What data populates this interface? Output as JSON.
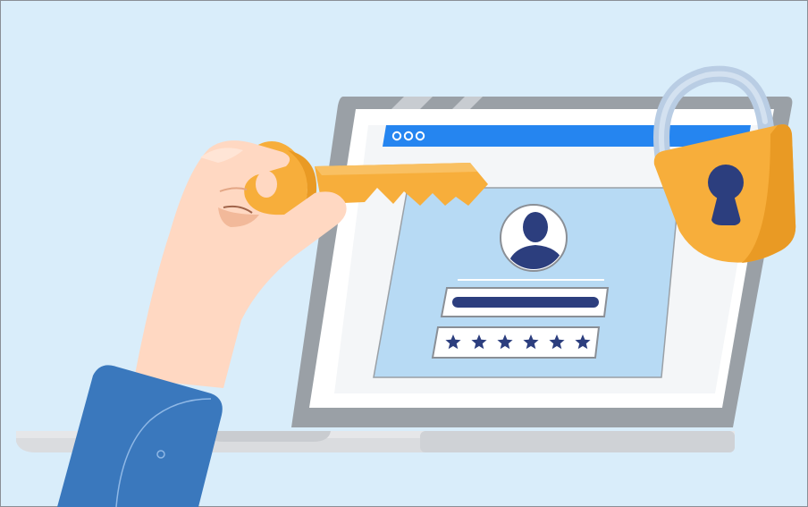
{
  "scene": {
    "subject": "login-security-illustration",
    "colors": {
      "background": "#D9EDFA",
      "frame_border": "#8A8F96",
      "laptop_frame": "#9AA0A6",
      "laptop_screen": "#FFFFFF",
      "laptop_base": "#DADCDF",
      "browser_bar": "#2585F0",
      "browser_dots": "#FFFFFF",
      "login_panel": "#B7DAF4",
      "avatar_fill": "#2C3E7E",
      "field_border": "#8A8F96",
      "text_line": "#2C3E7E",
      "password_star": "#2C3E7E",
      "key": "#F7AE3B",
      "padlock_body": "#F7AE3B",
      "padlock_shackle": "#B9CDE4",
      "keyhole": "#2C3E7E",
      "hand_skin": "#FFD8C2",
      "hand_shadow": "#F2B99A",
      "sleeve": "#3A78BD"
    },
    "password_mask_count": 6,
    "browser_dot_count": 3
  }
}
